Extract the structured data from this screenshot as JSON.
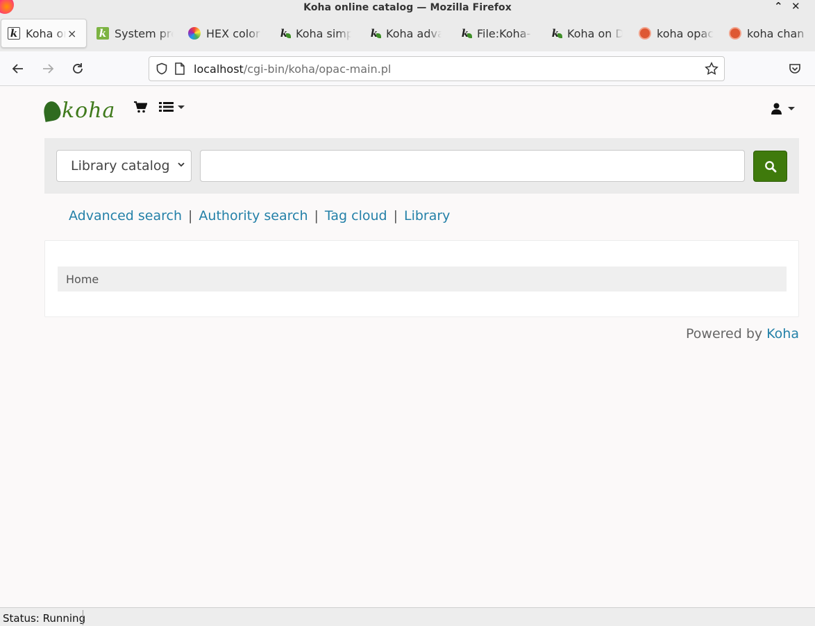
{
  "window": {
    "title": "Koha online catalog — Mozilla Firefox",
    "minimize_glyph": "⌃",
    "close_glyph": "✕"
  },
  "tabs": [
    {
      "label": "Koha online catalog",
      "icon": "koha-k-icon",
      "active": true
    },
    {
      "label": "System preferences",
      "icon": "koha-k-green-icon",
      "active": false
    },
    {
      "label": "HEX color",
      "icon": "color-wheel-icon",
      "active": false
    },
    {
      "label": "Koha simple",
      "icon": "koha-leaf-icon",
      "active": false
    },
    {
      "label": "Koha advanced",
      "icon": "koha-leaf-icon",
      "active": false
    },
    {
      "label": "File:Koha-",
      "icon": "koha-leaf-icon",
      "active": false
    },
    {
      "label": "Koha on D",
      "icon": "koha-leaf-icon",
      "active": false
    },
    {
      "label": "koha opac",
      "icon": "duckduckgo-icon",
      "active": false
    },
    {
      "label": "koha chan",
      "icon": "duckduckgo-icon",
      "active": false
    }
  ],
  "tab_close_glyph": "×",
  "navbar": {
    "url_host": "localhost",
    "url_path": "/cgi-bin/koha/opac-main.pl"
  },
  "header": {
    "logo_text": "koha"
  },
  "search": {
    "scope_selected": "Library catalog",
    "query_value": ""
  },
  "links": {
    "advanced": "Advanced search",
    "authority": "Authority search",
    "tagcloud": "Tag cloud",
    "library": "Library",
    "separator": "|"
  },
  "breadcrumb": {
    "home": "Home"
  },
  "footer": {
    "powered_prefix": "Powered by",
    "powered_link": "Koha"
  },
  "status": {
    "text": "Status: Running"
  },
  "colors": {
    "accent_green": "#3f7a0c",
    "link_blue": "#2380a8"
  }
}
